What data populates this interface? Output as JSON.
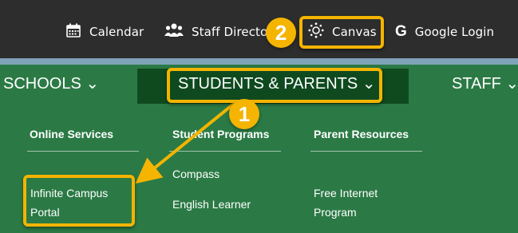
{
  "topbar": {
    "links": [
      {
        "label": "Calendar",
        "icon": "calendar-icon"
      },
      {
        "label": "Staff Directo",
        "icon": "people-icon"
      },
      {
        "label": "Canvas",
        "icon": "canvas-icon"
      },
      {
        "label": "Google Login",
        "icon": "google-icon"
      }
    ]
  },
  "nav": {
    "schools": "SCHOOLS ⌄",
    "students_parents": "STUDENTS & PARENTS ⌄",
    "staff": "STAFF ⌄"
  },
  "menu": {
    "online_services": {
      "heading": "Online Services",
      "links": [
        "Infinite Campus",
        "Portal"
      ]
    },
    "student_programs": {
      "heading": "Student Programs",
      "links": [
        "Compass",
        "English Learner"
      ]
    },
    "parent_resources": {
      "heading": "Parent Resources",
      "links": [
        "Free Internet",
        "Program"
      ]
    }
  },
  "annotations": {
    "step1": "1",
    "step2": "2"
  },
  "colors": {
    "highlight": "#f4b400",
    "nav_green": "#2b7a45",
    "nav_active": "#0f4a1f",
    "topbar": "#2d2d2d"
  }
}
